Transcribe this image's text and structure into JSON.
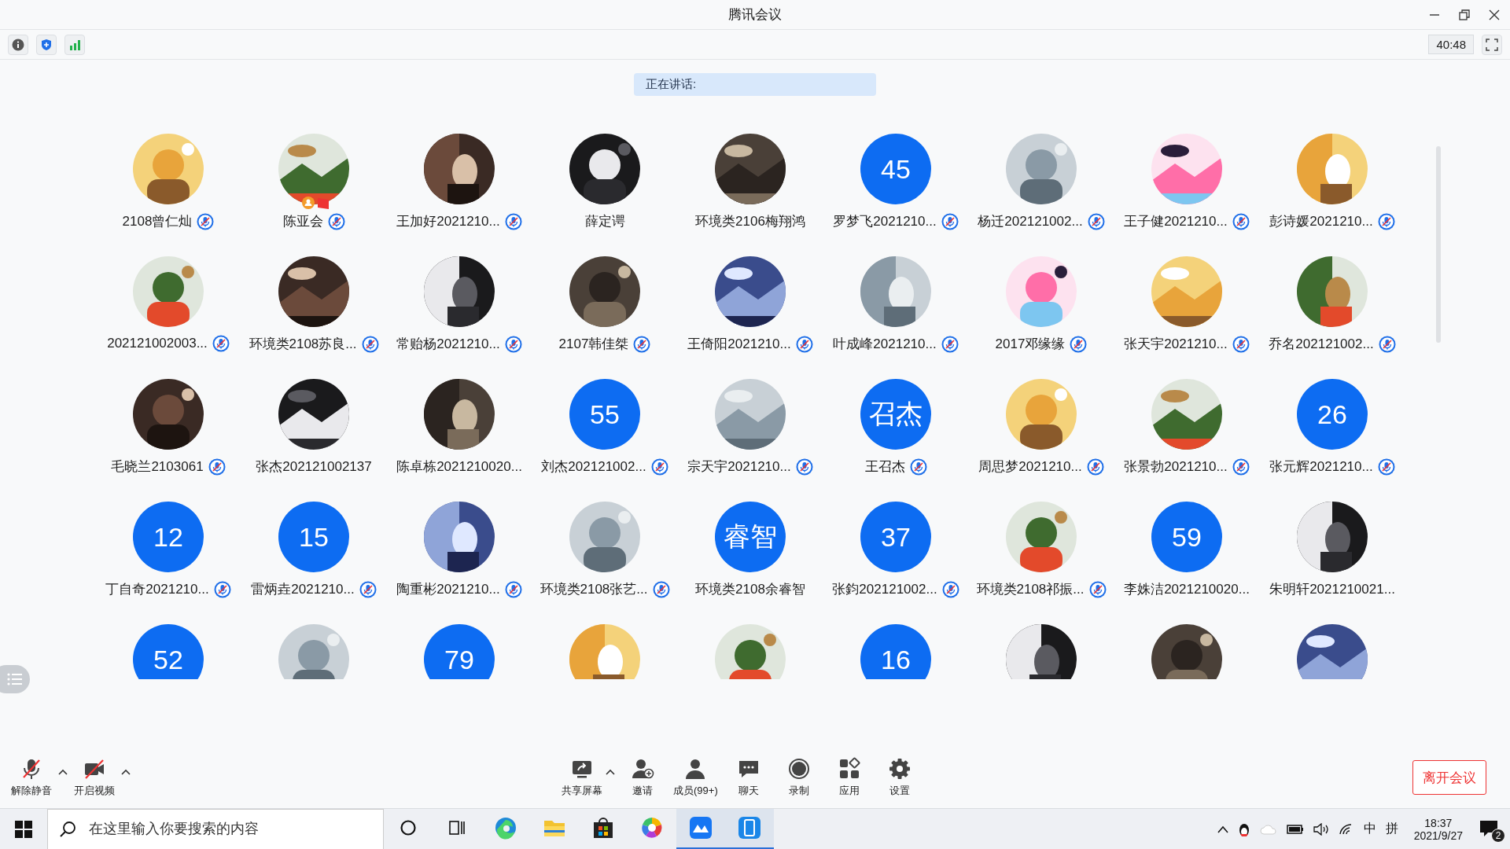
{
  "window": {
    "title": "腾讯会议"
  },
  "toolbar": {
    "timer": "40:48"
  },
  "speaking": {
    "label": "正在讲话:"
  },
  "participants": [
    {
      "name": "2108曾仁灿",
      "avatar": {
        "kind": "picture"
      },
      "muted": true,
      "host": false
    },
    {
      "name": "陈亚会",
      "avatar": {
        "kind": "picture"
      },
      "muted": true,
      "host": true
    },
    {
      "name": "王加好2021210...",
      "avatar": {
        "kind": "picture"
      },
      "muted": true,
      "host": false
    },
    {
      "name": "薛定谔",
      "avatar": {
        "kind": "picture"
      },
      "muted": false,
      "host": false
    },
    {
      "name": "环境类2106梅翔鸿",
      "avatar": {
        "kind": "picture"
      },
      "muted": false,
      "host": false
    },
    {
      "name": "罗梦飞2021210...",
      "avatar": {
        "kind": "text",
        "text": "45"
      },
      "muted": true,
      "host": false
    },
    {
      "name": "杨迁202121002...",
      "avatar": {
        "kind": "picture"
      },
      "muted": true,
      "host": false
    },
    {
      "name": "王子健2021210...",
      "avatar": {
        "kind": "picture"
      },
      "muted": true,
      "host": false
    },
    {
      "name": "彭诗媛2021210...",
      "avatar": {
        "kind": "picture"
      },
      "muted": true,
      "host": false
    },
    {
      "name": "202121002003...",
      "avatar": {
        "kind": "picture"
      },
      "muted": true,
      "host": false
    },
    {
      "name": "环境类2108苏良...",
      "avatar": {
        "kind": "picture"
      },
      "muted": true,
      "host": false
    },
    {
      "name": "常贻杨2021210...",
      "avatar": {
        "kind": "picture"
      },
      "muted": true,
      "host": false
    },
    {
      "name": "2107韩佳桀",
      "avatar": {
        "kind": "picture"
      },
      "muted": true,
      "host": false
    },
    {
      "name": "王倚阳2021210...",
      "avatar": {
        "kind": "picture"
      },
      "muted": true,
      "host": false
    },
    {
      "name": "叶成峰2021210...",
      "avatar": {
        "kind": "picture"
      },
      "muted": true,
      "host": false
    },
    {
      "name": "2017邓缘缘",
      "avatar": {
        "kind": "picture"
      },
      "muted": true,
      "host": false
    },
    {
      "name": "张天宇2021210...",
      "avatar": {
        "kind": "picture"
      },
      "muted": true,
      "host": false
    },
    {
      "name": "乔名202121002...",
      "avatar": {
        "kind": "picture"
      },
      "muted": true,
      "host": false
    },
    {
      "name": "毛晓兰2103061",
      "avatar": {
        "kind": "picture"
      },
      "muted": true,
      "host": false
    },
    {
      "name": "张杰202121002137",
      "avatar": {
        "kind": "picture"
      },
      "muted": false,
      "host": false
    },
    {
      "name": "陈卓栋2021210020...",
      "avatar": {
        "kind": "picture"
      },
      "muted": false,
      "host": false
    },
    {
      "name": "刘杰202121002...",
      "avatar": {
        "kind": "text",
        "text": "55"
      },
      "muted": true,
      "host": false
    },
    {
      "name": "宗天宇2021210...",
      "avatar": {
        "kind": "picture"
      },
      "muted": true,
      "host": false
    },
    {
      "name": "王召杰",
      "avatar": {
        "kind": "text",
        "text": "召杰"
      },
      "muted": true,
      "host": false
    },
    {
      "name": "周思梦2021210...",
      "avatar": {
        "kind": "picture"
      },
      "muted": true,
      "host": false
    },
    {
      "name": "张景勃2021210...",
      "avatar": {
        "kind": "picture"
      },
      "muted": true,
      "host": false
    },
    {
      "name": "张元辉2021210...",
      "avatar": {
        "kind": "text",
        "text": "26"
      },
      "muted": true,
      "host": false
    },
    {
      "name": "丁自奇2021210...",
      "avatar": {
        "kind": "text",
        "text": "12"
      },
      "muted": true,
      "host": false
    },
    {
      "name": "雷炳垚2021210...",
      "avatar": {
        "kind": "text",
        "text": "15"
      },
      "muted": true,
      "host": false
    },
    {
      "name": "陶重彬2021210...",
      "avatar": {
        "kind": "picture"
      },
      "muted": true,
      "host": false
    },
    {
      "name": "环境类2108张艺...",
      "avatar": {
        "kind": "picture"
      },
      "muted": true,
      "host": false
    },
    {
      "name": "环境类2108余睿智",
      "avatar": {
        "kind": "text",
        "text": "睿智"
      },
      "muted": false,
      "host": false
    },
    {
      "name": "张鈞202121002...",
      "avatar": {
        "kind": "text",
        "text": "37"
      },
      "muted": true,
      "host": false
    },
    {
      "name": "环境类2108祁振...",
      "avatar": {
        "kind": "picture"
      },
      "muted": true,
      "host": false
    },
    {
      "name": "李姝洁2021210020...",
      "avatar": {
        "kind": "text",
        "text": "59"
      },
      "muted": false,
      "host": false
    },
    {
      "name": "朱明轩2021210021...",
      "avatar": {
        "kind": "picture"
      },
      "muted": false,
      "host": false
    }
  ],
  "partial_row": [
    {
      "kind": "text",
      "text": "52"
    },
    {
      "kind": "picture"
    },
    {
      "kind": "text",
      "text": "79"
    },
    {
      "kind": "picture"
    },
    {
      "kind": "picture"
    },
    {
      "kind": "text",
      "text": "16"
    },
    {
      "kind": "picture"
    },
    {
      "kind": "picture"
    },
    {
      "kind": "picture"
    }
  ],
  "controls_left": [
    {
      "kind": "mic",
      "label": "解除静音"
    },
    {
      "kind": "video",
      "label": "开启视频"
    }
  ],
  "controls_center": [
    {
      "kind": "share",
      "label": "共享屏幕",
      "caret": true
    },
    {
      "kind": "invite",
      "label": "邀请",
      "caret": false
    },
    {
      "kind": "members",
      "label": "成员(99+)",
      "caret": false
    },
    {
      "kind": "chat",
      "label": "聊天",
      "caret": false
    },
    {
      "kind": "record",
      "label": "录制",
      "caret": false
    },
    {
      "kind": "apps",
      "label": "应用",
      "caret": false
    },
    {
      "kind": "settings",
      "label": "设置",
      "caret": false
    }
  ],
  "leave_button": "离开会议",
  "taskbar": {
    "search": {
      "placeholder": "在这里输入你要搜索的内容"
    },
    "apps": [
      {
        "kind": "cortana",
        "active": false
      },
      {
        "kind": "taskview",
        "active": false
      },
      {
        "kind": "edge",
        "active": false
      },
      {
        "kind": "explorer",
        "active": false
      },
      {
        "kind": "store",
        "active": false
      },
      {
        "kind": "color",
        "active": false
      },
      {
        "kind": "meeting",
        "active": true
      },
      {
        "kind": "phone",
        "active": true
      }
    ],
    "ime_lang": "中",
    "ime_mode": "拼",
    "time": "18:37",
    "date": "2021/9/27",
    "notifications": "2"
  }
}
